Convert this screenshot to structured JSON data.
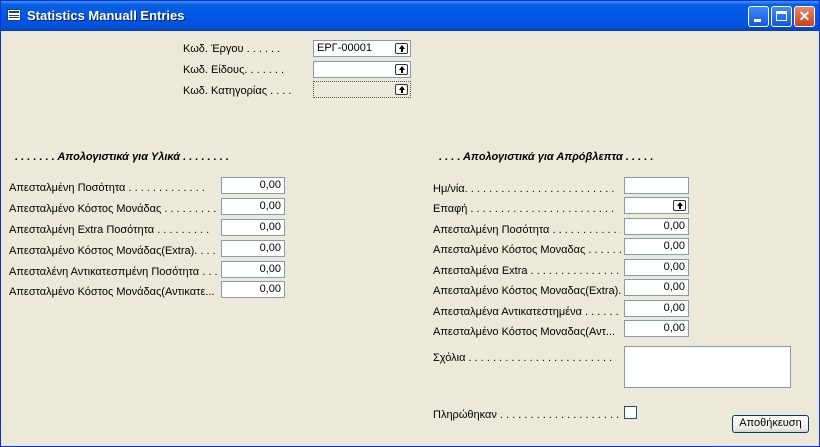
{
  "window": {
    "title": "Statistics Manuall Entries"
  },
  "header": {
    "fields": [
      {
        "label": "Κωδ. Έργου  . . . . . .",
        "value": "ΕΡΓ-00001"
      },
      {
        "label": "Κωδ. Είδους. . . . . . .",
        "value": ""
      },
      {
        "label": "Κωδ. Κατηγορίας  . . . .",
        "value": ""
      }
    ]
  },
  "materials": {
    "title": ". . . . . . .  Απολογιστικά για Υλικά . . . . . . . .",
    "fields": [
      {
        "label": "Απεσταλμένη Ποσότητα  . . . . . . . . . . . . .",
        "value": "0,00"
      },
      {
        "label": "Απεσταλμένο Κόστος Μονάδας  . . . . . . . . .",
        "value": "0,00"
      },
      {
        "label": "Απεσταλμένη Extra Ποσότητα  . . . . . . . . .",
        "value": "0,00"
      },
      {
        "label": "Απεσταλμένο Κόστος Μονάδας(Extra). . . . .",
        "value": "0,00"
      },
      {
        "label": "Απεσταλένη Αντικατεσπμένη Ποσότητα  . . . .",
        "value": "0,00"
      },
      {
        "label": "Απεσταλμένο Κόστος Μονάδας(Αντικατε...",
        "value": "0,00"
      }
    ]
  },
  "unforeseen": {
    "title": ". . . .  Απολογιστικά για Απρόβλεπτα . . . . .",
    "fields": [
      {
        "label": "Ημ/νία. . . . . . . . . . . . . . . . . . . . . . . . .",
        "value": ""
      },
      {
        "label": "Επαφή  . . . . . . . . . . . . . . . . . . . . . . . .",
        "value": ""
      },
      {
        "label": "Απεσταλμένη Ποσότητα . . . . . . . . . . . . . .",
        "value": "0,00"
      },
      {
        "label": "Απεσταλμένο Κόστος Μοναδας  . . . . . . . . .",
        "value": "0,00"
      },
      {
        "label": "Απεσταλμένα Extra  . . . . . . . . . . . . . . . . .",
        "value": "0,00"
      },
      {
        "label": "Απεσταλμένο Κόστος Μοναδας(Extra). . . . .",
        "value": "0,00"
      },
      {
        "label": "Απεσταλμένα Αντικατεστημένα  . . . . . . . . .",
        "value": "0,00"
      },
      {
        "label": "Απεσταλμένο Κόστος Μοναδας(Αντ...",
        "value": "0,00"
      }
    ],
    "comments_label": "Σχόλια  . . . . . . . . . . . . . . . . . . . . . . . .",
    "comments_value": "",
    "paid_label": "Πληρώθηκαν  . . . . . . . . . . . . . . . . . . . .",
    "paid_checked": false
  },
  "buttons": {
    "save": "Αποθήκευση"
  }
}
